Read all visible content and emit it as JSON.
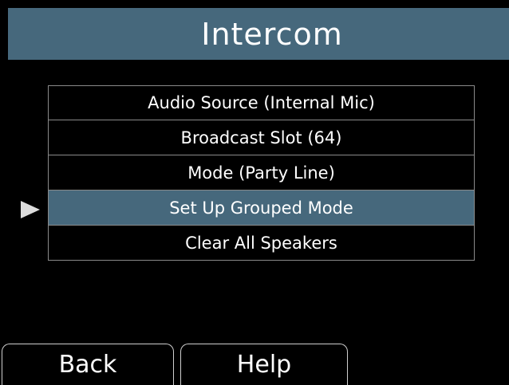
{
  "header": {
    "title": "Intercom"
  },
  "menu": {
    "items": [
      {
        "label": "Audio Source (Internal Mic)",
        "selected": false
      },
      {
        "label": "Broadcast Slot (64)",
        "selected": false
      },
      {
        "label": "Mode (Party Line)",
        "selected": false
      },
      {
        "label": "Set Up Grouped Mode",
        "selected": true
      },
      {
        "label": "Clear All Speakers",
        "selected": false
      }
    ],
    "pointer_icon": "right-triangle-pointer"
  },
  "softkeys": {
    "back_label": "Back",
    "help_label": "Help"
  },
  "colors": {
    "accent": "#46687c",
    "background": "#000000",
    "border": "#8a8a8a",
    "pointer": "#dcdcdc"
  }
}
